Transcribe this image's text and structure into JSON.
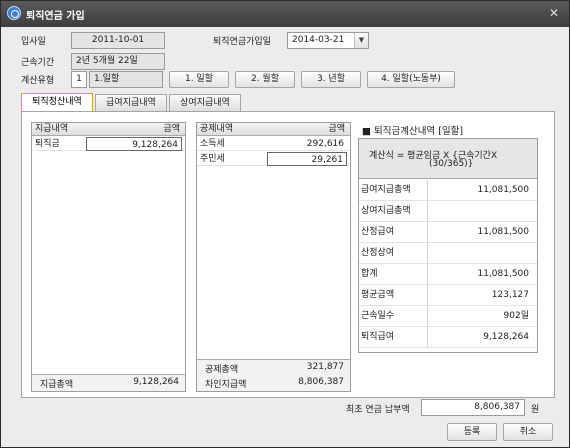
{
  "window": {
    "title": "퇴직연금 가입",
    "close_glyph": "✕"
  },
  "form": {
    "hire_date_label": "입사일",
    "hire_date": "2011-10-01",
    "pension_join_label": "퇴직연금가입일",
    "pension_join_date": "2014-03-21",
    "service_label": "근속기간",
    "service_period": "2년 5개월 22일",
    "calc_type_label": "계산유형",
    "calc_type_code": "1",
    "calc_type_name": "1.일할",
    "calc_type_buttons": [
      "1. 일할",
      "2. 월할",
      "3. 년할",
      "4. 일할(노동부)"
    ]
  },
  "tabs": [
    "퇴직정산내역",
    "급여지급내역",
    "상여지급내역"
  ],
  "payment_grid": {
    "headers": [
      "지급내역",
      "금액"
    ],
    "rows": [
      {
        "name": "퇴직금",
        "amount": "9,128,264"
      }
    ],
    "total_label": "지급총액",
    "total": "9,128,264"
  },
  "deduction_grid": {
    "headers": [
      "공제내역",
      "금액"
    ],
    "rows": [
      {
        "name": "소득세",
        "amount": "292,616"
      },
      {
        "name": "주민세",
        "amount": "29,261"
      }
    ],
    "total_label": "공제총액",
    "total": "321,877",
    "net_label": "차인지급액",
    "net": "8,806,387"
  },
  "calc": {
    "title": "■ 퇴직금계산내역 [일할]",
    "formula_line1": "계산식 = 평균임금 X {근속기간X",
    "formula_line2": "(30/365)}",
    "rows": [
      {
        "label": "급여지급총액",
        "value": "11,081,500"
      },
      {
        "label": "상여지급총액",
        "value": ""
      },
      {
        "label": "산정급여",
        "value": "11,081,500"
      },
      {
        "label": "산정상여",
        "value": ""
      },
      {
        "label": "합계",
        "value": "11,081,500"
      },
      {
        "label": "평균금액",
        "value": "123,127"
      },
      {
        "label": "근속일수",
        "value": "902일"
      },
      {
        "label": "퇴직급여",
        "value": "9,128,264"
      }
    ]
  },
  "bottom": {
    "final_label": "최초 연금 납부액",
    "final_amount": "8,806,387",
    "unit": "원",
    "register_label": "등록",
    "cancel_label": "취소"
  }
}
